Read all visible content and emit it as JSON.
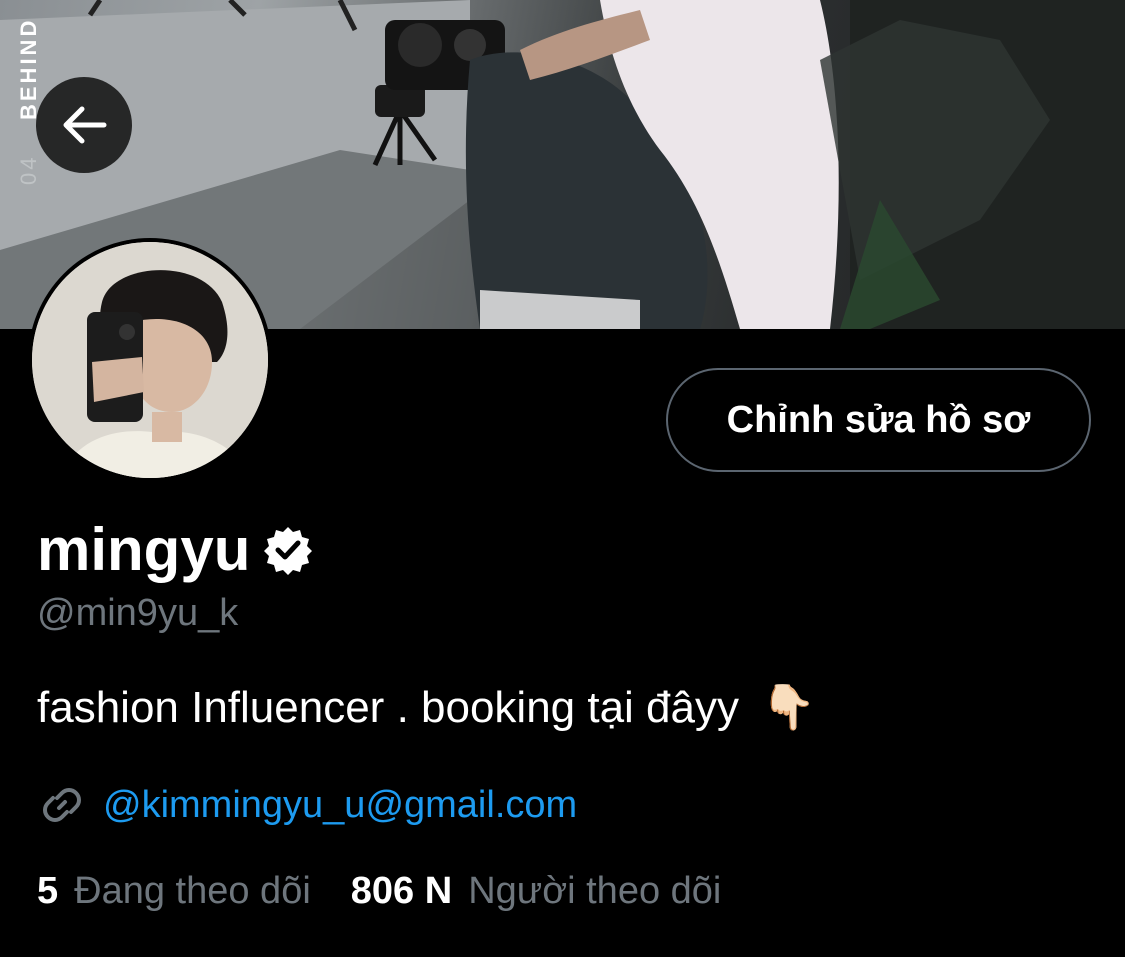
{
  "banner": {
    "caption_number": "04",
    "caption_word": "BEHIND"
  },
  "header": {
    "back_icon": "arrow-left-icon"
  },
  "profile": {
    "edit_button_label": "Chỉnh sửa hồ sơ",
    "display_name": "mingyu",
    "verified_icon": "verified-badge-icon",
    "handle": "@min9yu_k",
    "bio": "fashion Influencer . booking tại đâyy",
    "bio_emoji": "👇🏻",
    "link_icon": "link-icon",
    "link": "@kimmingyu_u@gmail.com"
  },
  "stats": {
    "following_count": "5",
    "following_label": "Đang theo dõi",
    "followers_count": "806 N",
    "followers_label": "Người theo dõi"
  },
  "colors": {
    "background": "#000000",
    "link": "#1d9bf0",
    "muted": "#6e767d",
    "button_border": "#5b6570"
  }
}
